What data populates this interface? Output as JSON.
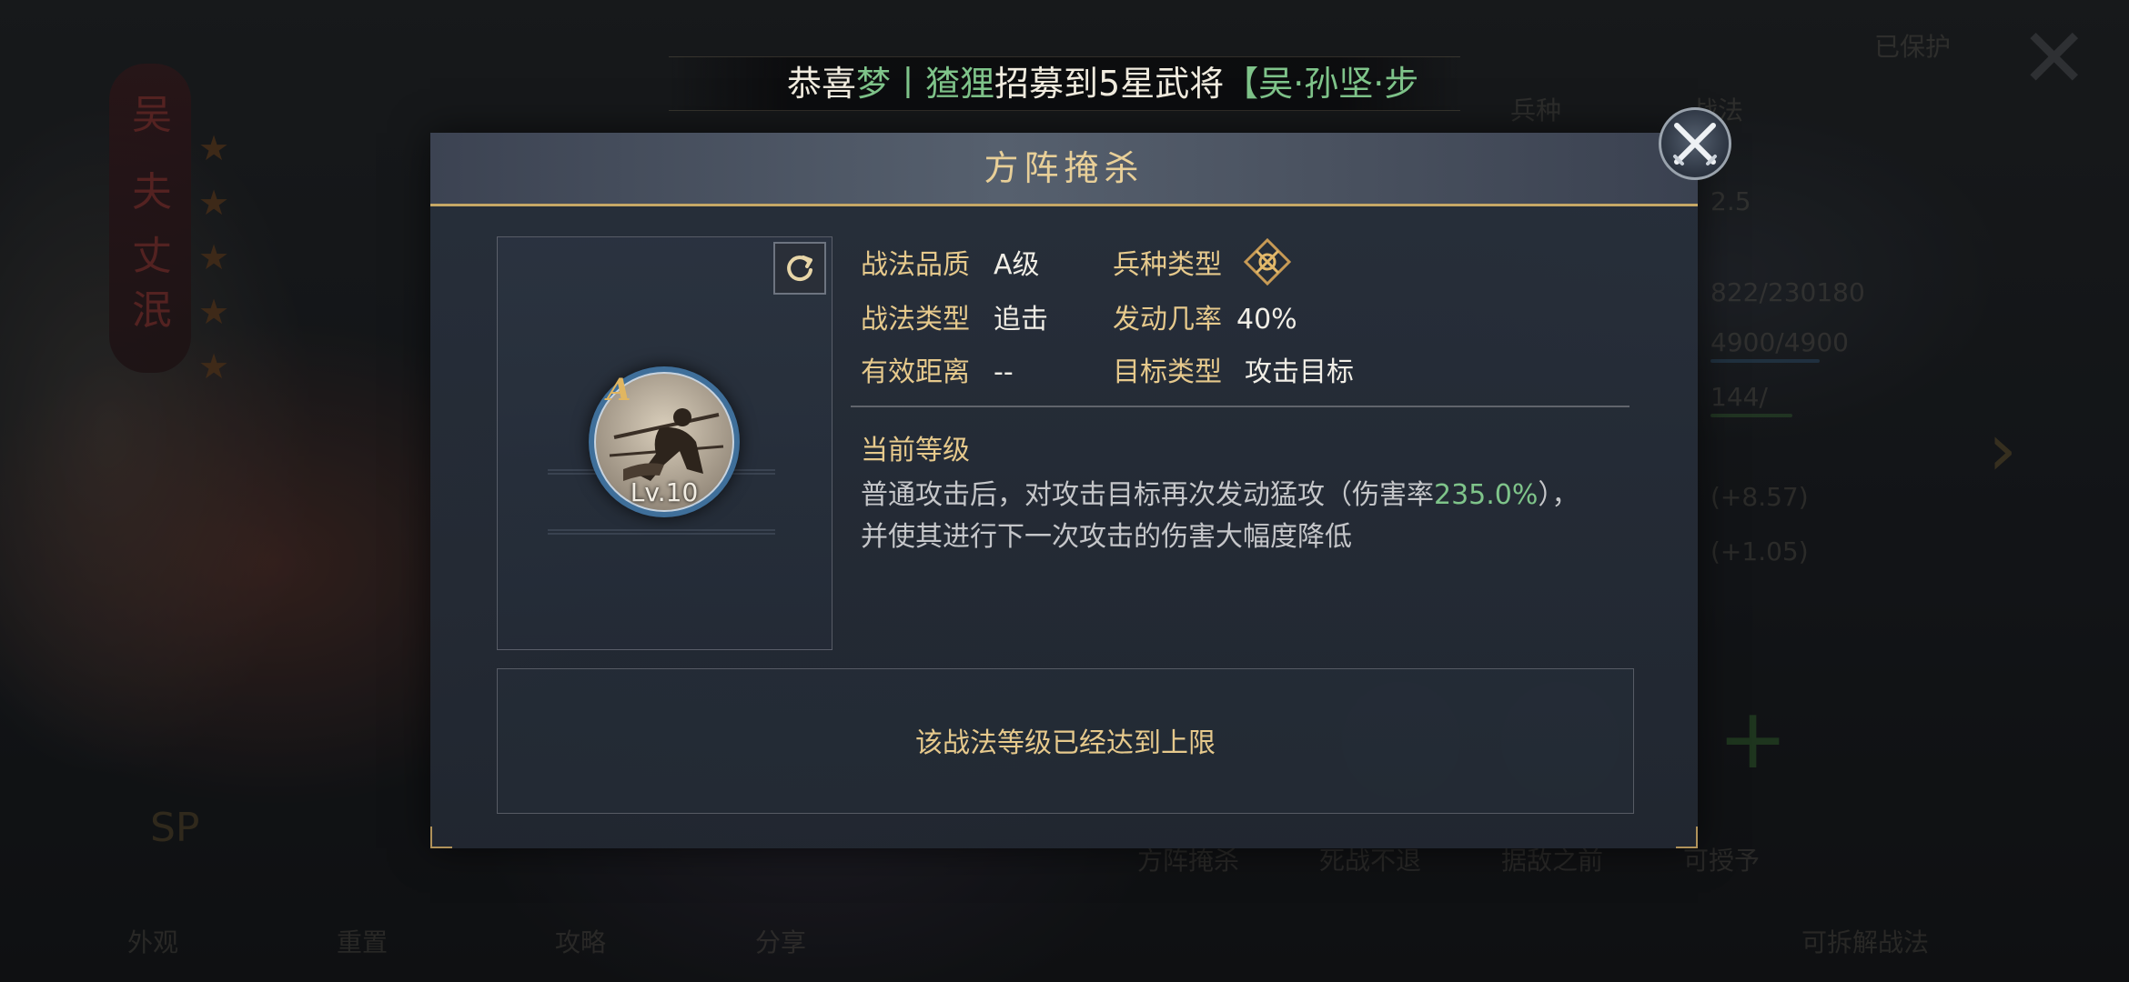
{
  "announcement": {
    "prefix": "恭喜",
    "player": "梦丨猹狸",
    "middle": "招募到5星武将",
    "general": "【吴·孙坚·步"
  },
  "dialog": {
    "title": "方阵掩杀",
    "skill": {
      "grade": "A",
      "level": "Lv.10"
    },
    "info": {
      "quality_label": "战法品质",
      "quality_value": "A级",
      "arm_label": "兵种类型",
      "arm_icon": "crossed-arms-icon",
      "type_label": "战法类型",
      "type_value": "追击",
      "rate_label": "发动几率",
      "rate_value": "40%",
      "range_label": "有效距离",
      "range_value": "--",
      "target_label": "目标类型",
      "target_value": "攻击目标"
    },
    "current_level_label": "当前等级",
    "description": {
      "part1": "普通攻击后，对攻击目标再次发动猛攻（伤害率",
      "rate": "235.0%",
      "part2": "），",
      "line2": "并使其进行下一次攻击的伤害大幅度降低"
    },
    "max_level_message": "该战法等级已经达到上限"
  },
  "colors": {
    "gold": "#e6c98c",
    "highlight_green": "#7fc48a",
    "panel_bg": "#28303c"
  }
}
